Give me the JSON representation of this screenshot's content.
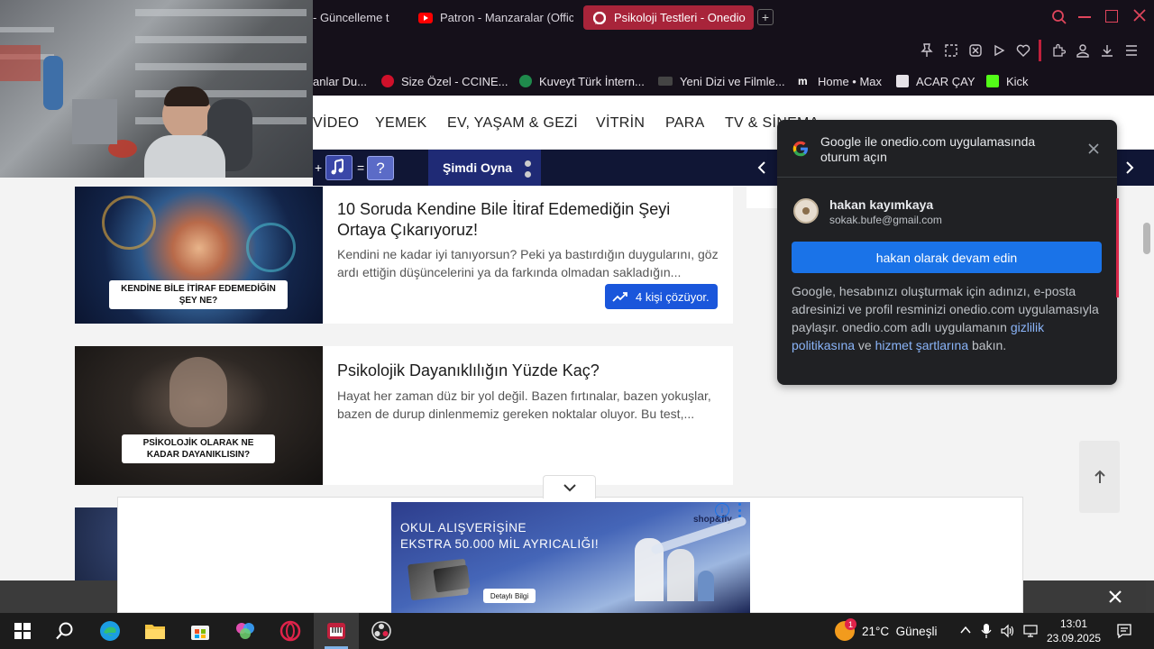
{
  "browser": {
    "tabs": [
      {
        "label": "- Güncelleme t"
      },
      {
        "label": "Patron - Manzaralar (Offic"
      },
      {
        "label": "Psikoloji Testleri - Onedio"
      }
    ],
    "new_tab_symbol": "+"
  },
  "bookmarks": [
    {
      "label": "anlar Du..."
    },
    {
      "label": "Size Özel - CCINE..."
    },
    {
      "label": "Kuveyt Türk İntern..."
    },
    {
      "label": "Yeni Dizi ve Filmle..."
    },
    {
      "label": "Home • Max"
    },
    {
      "label": "ACAR ÇAY"
    },
    {
      "label": "Kick"
    }
  ],
  "site_nav": {
    "items": [
      "VİDEO",
      "YEMEK",
      "EV, YAŞAM & GEZİ",
      "VİTRİN",
      "PARA",
      "TV & SİNEMA"
    ]
  },
  "game_bar": {
    "plus": "+",
    "equals": "=",
    "question": "?",
    "play_label": "Şimdi Oyna"
  },
  "articles": [
    {
      "title": "10 Soruda Kendine Bile İtiraf Edemediğin Şeyi Ortaya Çıkarıyoruz!",
      "description": "Kendini ne kadar iyi tanıyorsun? Peki ya bastırdığın duygularını, göz ardı ettiğin düşüncelerini ya da farkında olmadan sakladığın...",
      "thumb_caption": "KENDİNE BİLE İTİRAF EDEMEDİĞİN ŞEY NE?",
      "badge": "4 kişi çözüyor."
    },
    {
      "title": "Psikolojik Dayanıklılığın Yüzde Kaç?",
      "description": "Hayat her zaman düz bir yol değil. Bazen fırtınalar, bazen yokuşlar, bazen de durup dinlenmemiz gereken noktalar oluyor. Bu test,...",
      "thumb_caption": "PSİKOLOJİK OLARAK NE KADAR DAYANIKLISIN?"
    }
  ],
  "google_popup": {
    "title": "Google ile onedio.com uygulamasında oturum açın",
    "user_name": "hakan kayımkaya",
    "user_email": "sokak.bufe@gmail.com",
    "continue_button": "hakan olarak devam edin",
    "body_pre": "Google, hesabınızı oluşturmak için adınızı, e-posta adresinizi ve profil resminizi onedio.com uygulamasıyla paylaşır. onedio.com adlı uygulamanın ",
    "privacy_link": "gizlilik politikasına",
    "body_mid": " ve ",
    "terms_link": "hizmet şartlarına",
    "body_post": " bakın."
  },
  "ad": {
    "headline_1": "OKUL ALIŞVERİŞİNE",
    "headline_2": "EKSTRA 50.000 MİL AYRICALIĞI!",
    "brand": "shop&fly",
    "cta": "Detaylı Bilgi"
  },
  "taskbar": {
    "weather": "21°C  Güneşli",
    "weather_badge": "1",
    "time": "13:01",
    "date": "23.09.2025"
  },
  "colors": {
    "tab_active": "#a8243a",
    "google_button": "#1a73e8",
    "badge_blue": "#1a56db",
    "link_blue": "#8ab4f8"
  }
}
